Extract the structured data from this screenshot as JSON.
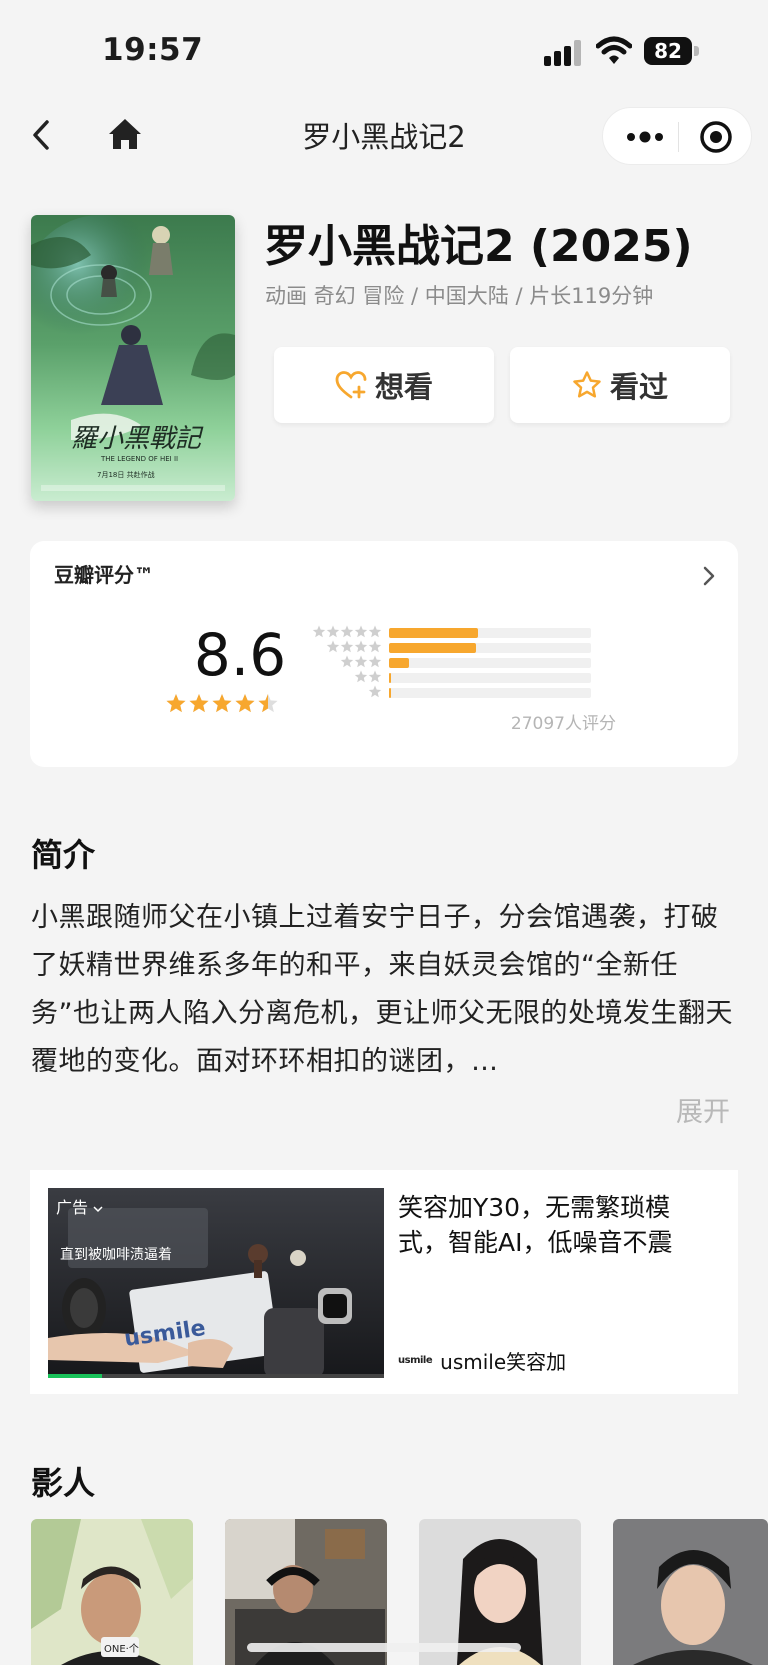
{
  "status_bar": {
    "time": "19:57",
    "battery": "82"
  },
  "nav": {
    "title": "罗小黑战记2"
  },
  "movie": {
    "title": "罗小黑战记2 (2025)",
    "meta": "动画 奇幻 冒险 / 中国大陆 / 片长119分钟",
    "poster_text": "羅小黑戰記",
    "poster_subtitle": "THE LEGEND OF HEI II",
    "poster_date": "7月18日 共赴作战"
  },
  "actions": {
    "want": "想看",
    "seen": "看过"
  },
  "rating": {
    "title": "豆瓣评分™",
    "score": "8.6",
    "stars": 4.5,
    "distribution": [
      0.44,
      0.43,
      0.1,
      0.01,
      0.01
    ],
    "count": "27097人评分"
  },
  "synopsis": {
    "title": "简介",
    "text": "小黑跟随师父在小镇上过着安宁日子，分会馆遇袭，打破了妖精世界维系多年的和平，来自妖灵会馆的“全新任务”也让两人陷入分离危机，更让师父无限的处境发生翻天覆地的变化。面对环环相扣的谜团，…",
    "expand": "展开"
  },
  "ad": {
    "tag": "广告",
    "caption": "直到被咖啡渍逼着",
    "product_text": "usmile",
    "headline": "笑容加Y30，无需繁琐模式，智能AI，低噪音不震",
    "brand_logo": "usmile",
    "brand_name": "usmile笑容加",
    "progress": 0.16
  },
  "cast": {
    "title": "影人",
    "photo_caption": "ONE·个"
  },
  "colors": {
    "accent": "#f7a72e",
    "background": "#f4f4f4",
    "card": "#ffffff"
  }
}
